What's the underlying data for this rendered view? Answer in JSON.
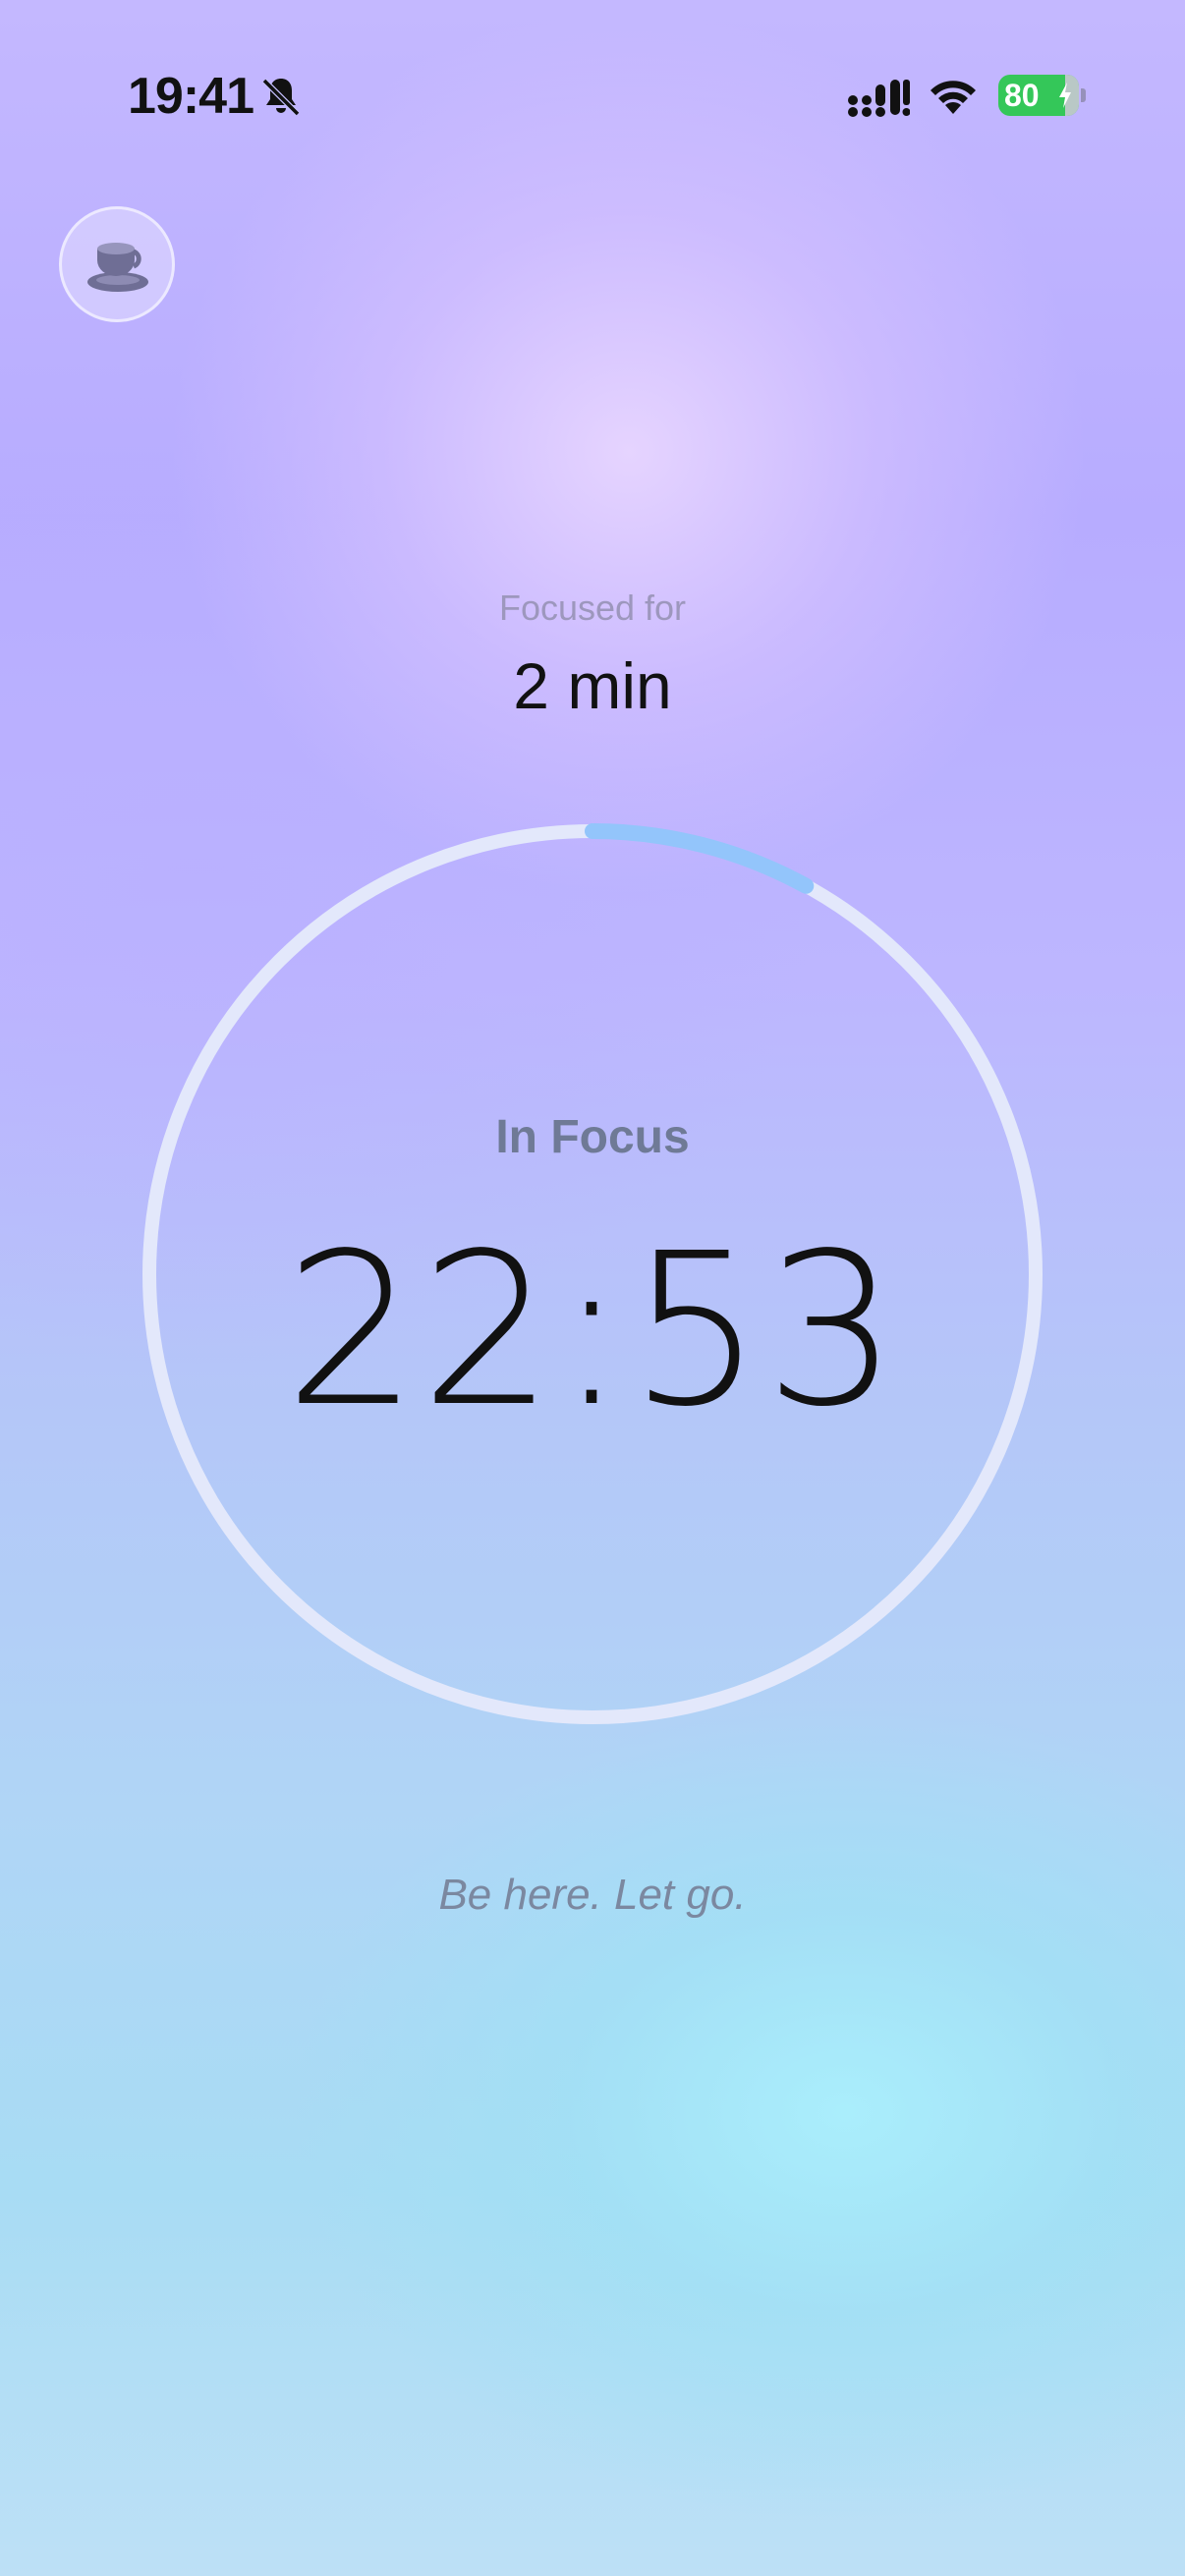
{
  "status_bar": {
    "time": "19:41",
    "battery_level": "80",
    "icons": [
      "bell-slash-icon",
      "cellular-signal-icon",
      "wifi-icon",
      "battery-charging-icon"
    ]
  },
  "break_button": {
    "icon": "coffee-cup-icon"
  },
  "session": {
    "focused_label": "Focused for",
    "focused_value": "2 min",
    "state_label": "In Focus",
    "timer": "22:53",
    "progress_fraction": 0.08,
    "mantra": "Be here. Let go."
  },
  "colors": {
    "progress_accent": "#93c5fb",
    "ring_track": "#e3e8fb",
    "battery": "#34c759"
  }
}
